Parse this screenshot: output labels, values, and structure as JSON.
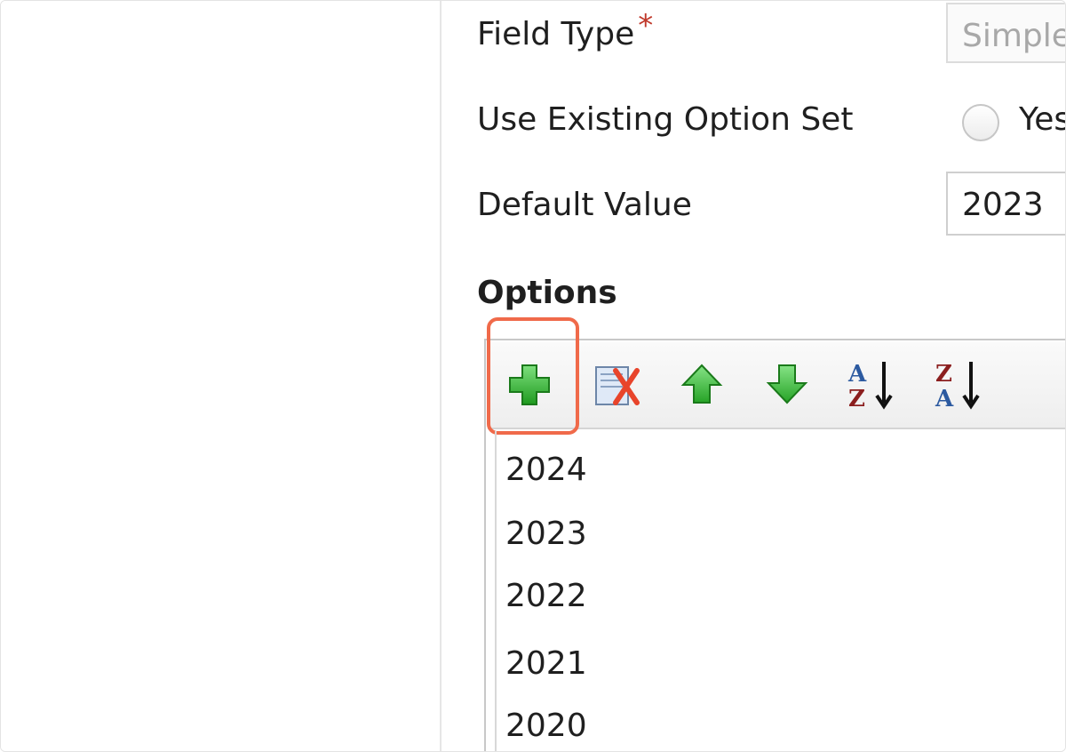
{
  "form": {
    "field_type_label": "Field Type",
    "required_marker": "*",
    "field_type_value": "Simple",
    "use_existing_label": "Use Existing Option Set",
    "use_existing_yes_label": "Yes",
    "default_value_label": "Default Value",
    "default_value_value": "2023"
  },
  "options": {
    "title": "Options",
    "toolbar": {
      "add": "add-option",
      "delete": "delete-option",
      "move_up": "move-up",
      "move_down": "move-down",
      "sort_asc": "sort-a-z",
      "sort_desc": "sort-z-a"
    },
    "items": [
      "2024",
      "2023",
      "2022",
      "2021",
      "2020"
    ]
  },
  "colors": {
    "required": "#c0392b",
    "highlight": "#f06a4a",
    "green_icon": "#3bb33b",
    "delete_icon": "#e8442b",
    "sort_letters": "#2c5aa0"
  }
}
